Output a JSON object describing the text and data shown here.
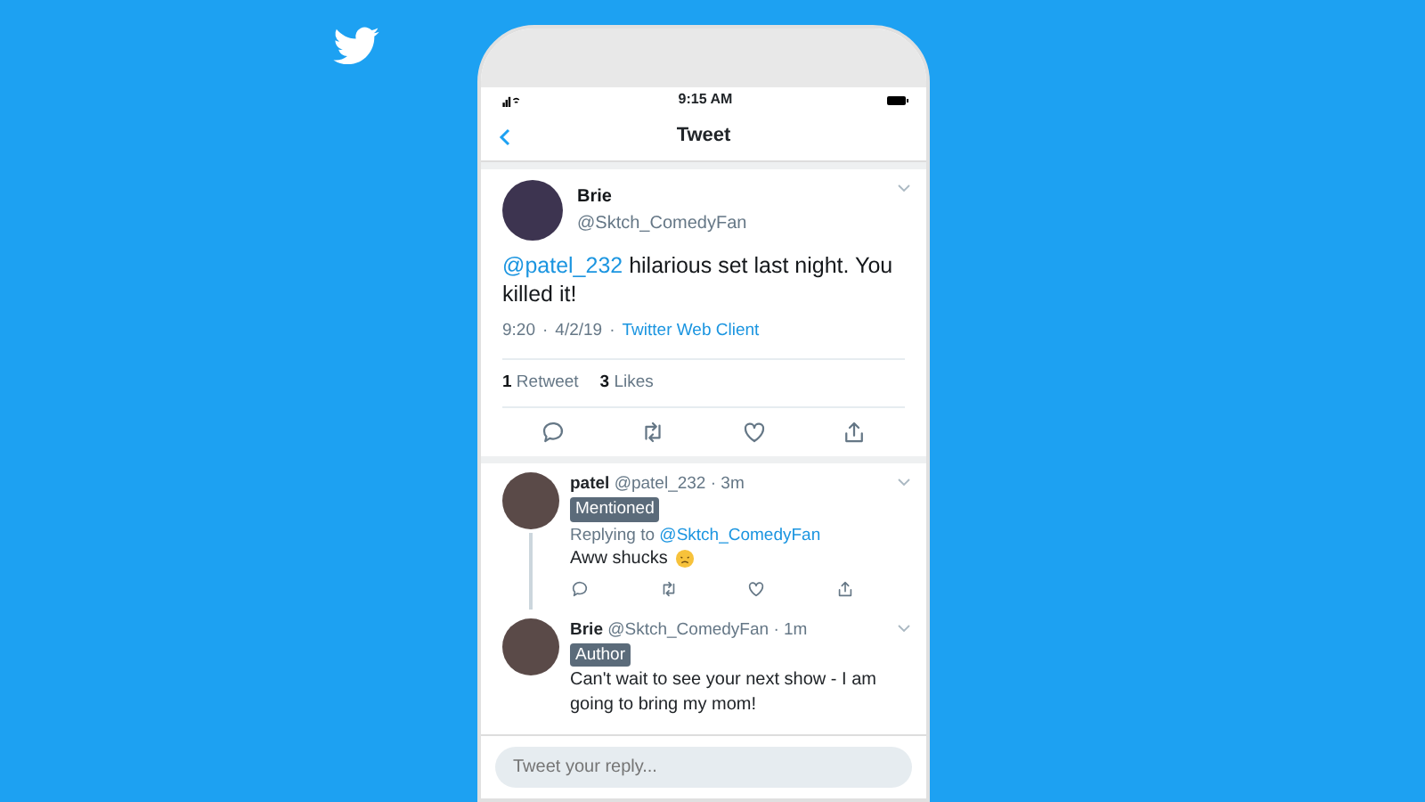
{
  "status_bar": {
    "time": "9:15 AM"
  },
  "nav": {
    "title": "Tweet"
  },
  "tweet": {
    "name": "Brie",
    "handle": "@Sktch_ComedyFan",
    "mention": "@patel_232",
    "text": "hilarious set last night. You killed it!",
    "time": "9:20",
    "separator": "·",
    "date": "4/2/19",
    "client": "Twitter Web Client",
    "stats": [
      {
        "count": "1",
        "label": "Retweet"
      },
      {
        "count": "3",
        "label": "Likes"
      }
    ]
  },
  "replies": [
    {
      "name": "patel",
      "handle": "@patel_232",
      "separator": "·",
      "time": "3m",
      "badge": "Mentioned",
      "replying_prefix": "Replying to",
      "replying_handle": "@Sktch_ComedyFan",
      "text": "Aww shucks",
      "emoji": true,
      "actions": true,
      "thread_continues": true
    },
    {
      "name": "Brie",
      "handle": "@Sktch_ComedyFan",
      "separator": "·",
      "time": "1m",
      "badge": "Author",
      "text": "Can't wait to see your next show - I am going to bring my mom!",
      "emoji": false,
      "actions": false,
      "thread_continues": false
    }
  ],
  "reply_box": {
    "placeholder": "Tweet your reply..."
  }
}
